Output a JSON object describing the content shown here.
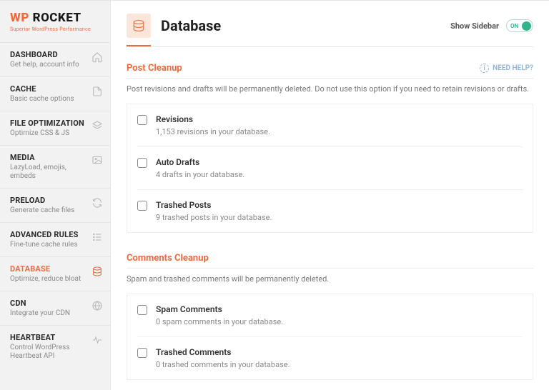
{
  "logo": {
    "wp": "WP",
    "rocket": "ROCKET",
    "tagline": "Superior WordPress Performance"
  },
  "nav": [
    {
      "title": "DASHBOARD",
      "sub": "Get help, account info"
    },
    {
      "title": "CACHE",
      "sub": "Basic cache options"
    },
    {
      "title": "FILE OPTIMIZATION",
      "sub": "Optimize CSS & JS"
    },
    {
      "title": "MEDIA",
      "sub": "LazyLoad, emojis, embeds"
    },
    {
      "title": "PRELOAD",
      "sub": "Generate cache files"
    },
    {
      "title": "ADVANCED RULES",
      "sub": "Fine-tune cache rules"
    },
    {
      "title": "DATABASE",
      "sub": "Optimize, reduce bloat"
    },
    {
      "title": "CDN",
      "sub": "Integrate your CDN"
    },
    {
      "title": "HEARTBEAT",
      "sub": "Control WordPress Heartbeat API"
    }
  ],
  "header": {
    "title": "Database",
    "show_sidebar": "Show Sidebar",
    "toggle": "ON",
    "need_help": "NEED HELP?"
  },
  "sections": [
    {
      "title": "Post Cleanup",
      "desc": "Post revisions and drafts will be permanently deleted. Do not use this option if you need to retain revisions or drafts.",
      "items": [
        {
          "title": "Revisions",
          "sub": "1,153 revisions in your database."
        },
        {
          "title": "Auto Drafts",
          "sub": "4 drafts in your database."
        },
        {
          "title": "Trashed Posts",
          "sub": "9 trashed posts in your database."
        }
      ]
    },
    {
      "title": "Comments Cleanup",
      "desc": "Spam and trashed comments will be permanently deleted.",
      "items": [
        {
          "title": "Spam Comments",
          "sub": "0 spam comments in your database."
        },
        {
          "title": "Trashed Comments",
          "sub": "0 trashed comments in your database."
        }
      ]
    }
  ]
}
